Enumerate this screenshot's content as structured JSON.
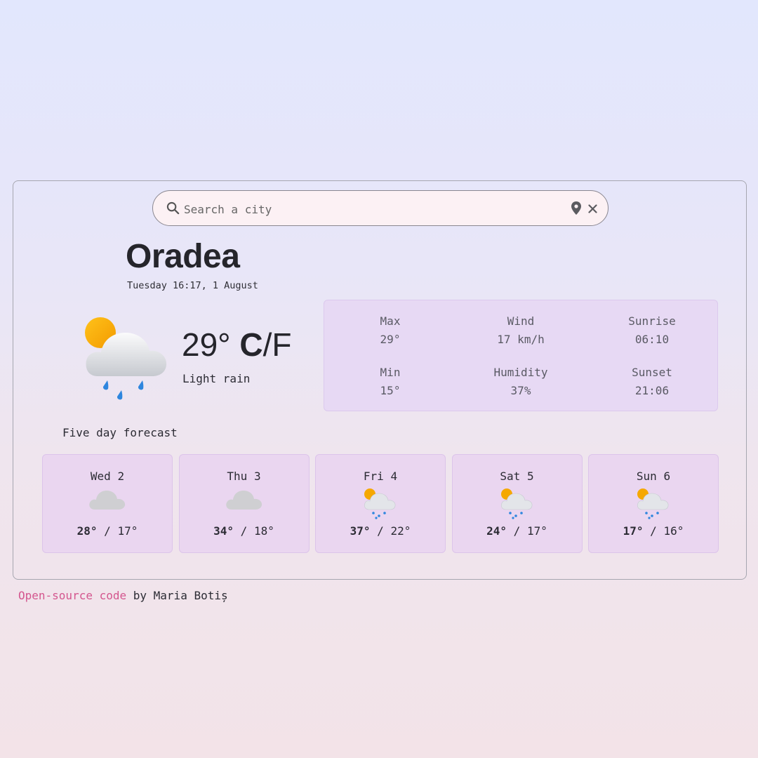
{
  "search": {
    "placeholder": "Search a city",
    "value": ""
  },
  "current": {
    "city": "Oradea",
    "datetime": "Tuesday 16:17, 1 August",
    "temperature": "29°",
    "unit_c": "C",
    "unit_separator": "/",
    "unit_f": "F",
    "description": "Light rain",
    "icon": "sun-cloud-rain-icon"
  },
  "details": {
    "max_label": "Max",
    "max_value": "29°",
    "wind_label": "Wind",
    "wind_value": "17 km/h",
    "sunrise_label": "Sunrise",
    "sunrise_value": "06:10",
    "min_label": "Min",
    "min_value": "15°",
    "humidity_label": "Humidity",
    "humidity_value": "37%",
    "sunset_label": "Sunset",
    "sunset_value": "21:06"
  },
  "forecast": {
    "title": "Five day forecast",
    "days": [
      {
        "name": "Wed 2",
        "high": "28°",
        "separator": "/",
        "low": "17°",
        "icon": "cloud-icon"
      },
      {
        "name": "Thu 3",
        "high": "34°",
        "separator": "/",
        "low": "18°",
        "icon": "cloud-icon"
      },
      {
        "name": "Fri 4",
        "high": "37°",
        "separator": "/",
        "low": "22°",
        "icon": "sun-cloud-rain-icon"
      },
      {
        "name": "Sat 5",
        "high": "24°",
        "separator": "/",
        "low": "17°",
        "icon": "sun-cloud-rain-icon"
      },
      {
        "name": "Sun 6",
        "high": "17°",
        "separator": "/",
        "low": "16°",
        "icon": "sun-cloud-rain-icon"
      }
    ]
  },
  "footer": {
    "link_text": "Open-source code",
    "suffix": " by Maria Botiș"
  },
  "colors": {
    "link": "#d4568e",
    "details_bg": "#e7d9f4",
    "forecast_card_bg": "#ead6f0",
    "search_bg": "#fcf1f4"
  }
}
